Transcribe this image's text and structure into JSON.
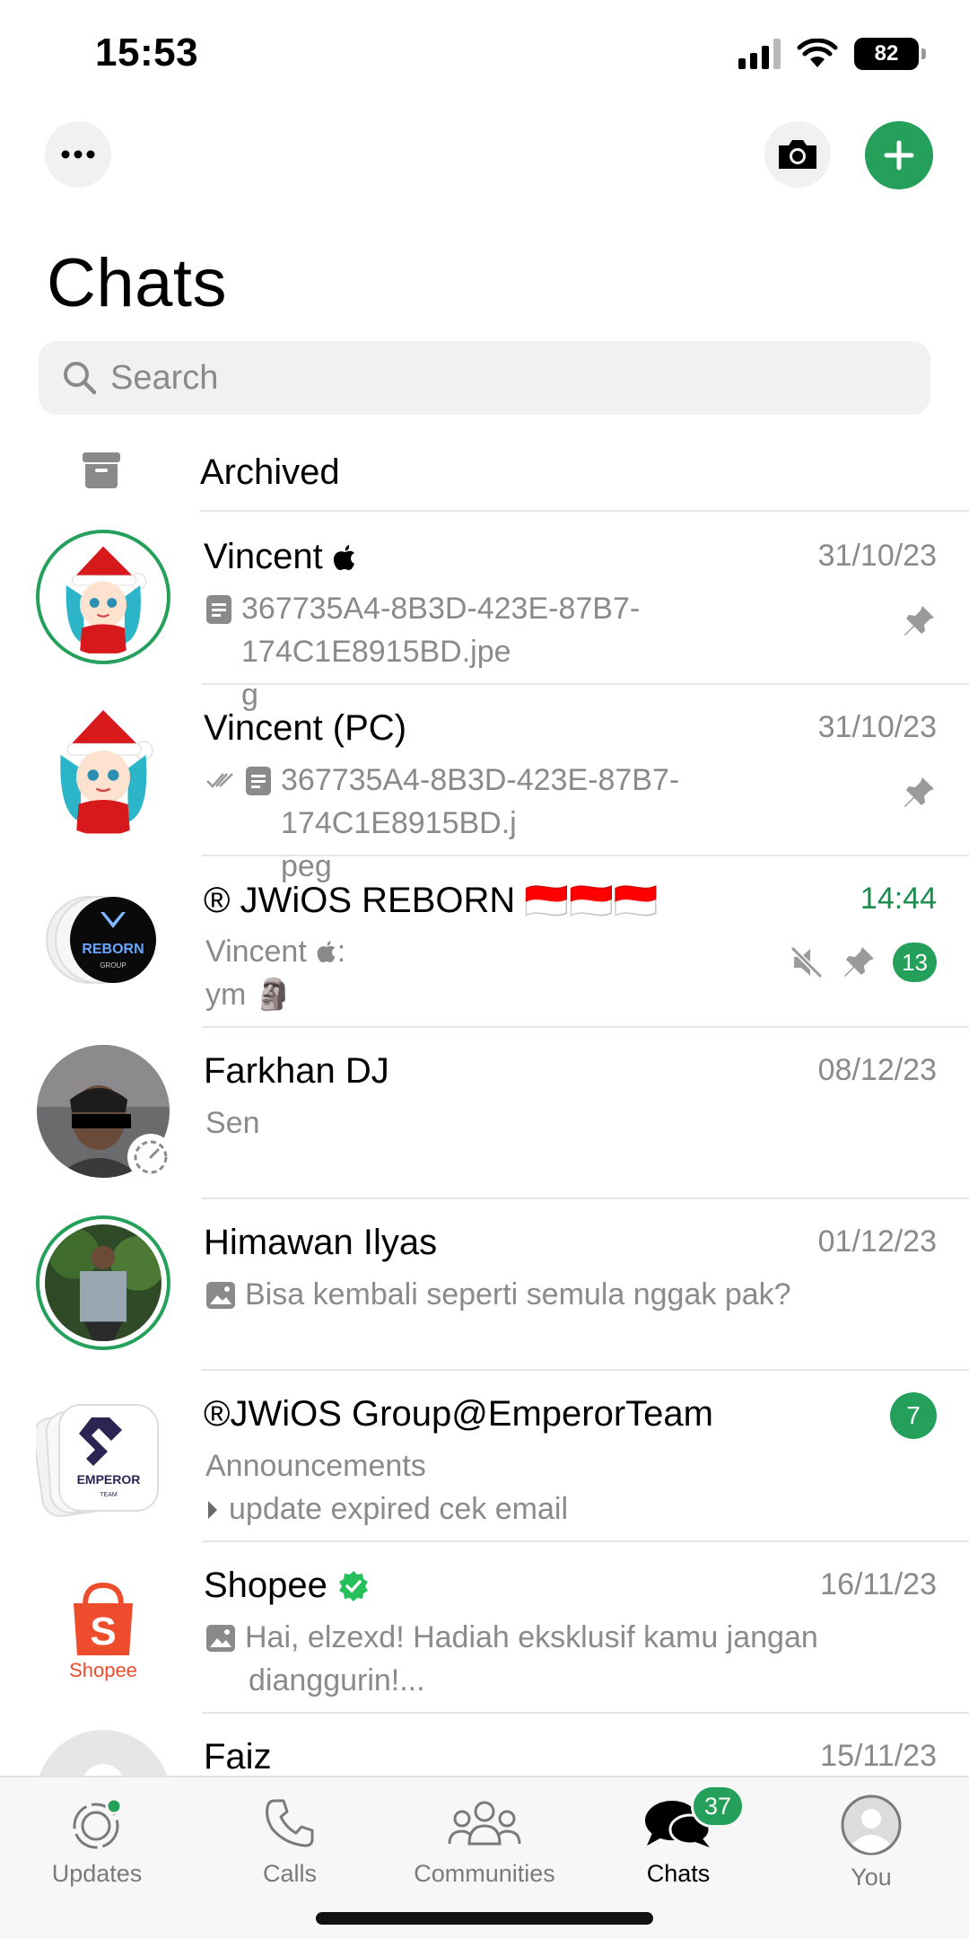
{
  "status_bar": {
    "time": "15:53",
    "battery": "82"
  },
  "header": {
    "title": "Chats"
  },
  "search": {
    "placeholder": "Search"
  },
  "archived": {
    "label": "Archived"
  },
  "chats": [
    {
      "name": "Vincent",
      "name_suffix": "",
      "time": "31/10/23",
      "preview_prefix": "",
      "preview_line1": "367735A4-8B3D-423E-87B7-174C1E8915BD.jpe",
      "preview_line2": "g",
      "badge": ""
    },
    {
      "name": "Vincent (PC)",
      "name_suffix": "",
      "time": "31/10/23",
      "preview_prefix": "",
      "preview_line1": "367735A4-8B3D-423E-87B7-174C1E8915BD.j",
      "preview_line2": "peg",
      "badge": ""
    },
    {
      "name": "® JWiOS REBORN",
      "name_suffix": "🇮🇩🇮🇩🇮🇩",
      "time": "14:44",
      "preview_prefix": "Vincent",
      "preview_line1": ":",
      "preview_line2": "ym 🗿",
      "badge": "13"
    },
    {
      "name": "Farkhan DJ",
      "name_suffix": "",
      "time": "08/12/23",
      "preview_prefix": "",
      "preview_line1": "Sen",
      "preview_line2": "",
      "badge": ""
    },
    {
      "name": "Himawan Ilyas",
      "name_suffix": "",
      "time": "01/12/23",
      "preview_prefix": "",
      "preview_line1": "Bisa kembali seperti semula nggak pak?",
      "preview_line2": "",
      "badge": ""
    },
    {
      "name": "®JWiOS Group@EmperorTeam",
      "name_suffix": "",
      "time": "",
      "preview_prefix": "",
      "preview_line1": "Announcements",
      "preview_line2": "update expired cek email",
      "badge": "7"
    },
    {
      "name": "Shopee",
      "name_suffix": "",
      "time": "16/11/23",
      "preview_prefix": "",
      "preview_line1": "Hai, elzexd! Hadiah eksklusif kamu jangan",
      "preview_line2": "dianggurin!...",
      "badge": ""
    },
    {
      "name": "Faiz",
      "name_suffix": "",
      "time": "15/11/23",
      "preview_prefix": "",
      "preview_line1": "",
      "preview_line2": "",
      "badge": ""
    }
  ],
  "avatars": {
    "reborn_logo_text": "REBORN",
    "reborn_logo_sub": "GROUP",
    "emperor_logo_text": "EMPEROR",
    "emperor_logo_sub": "TEAM",
    "shopee_logo_text": "Shopee"
  },
  "tab_bar": {
    "tabs": [
      {
        "label": "Updates"
      },
      {
        "label": "Calls"
      },
      {
        "label": "Communities"
      },
      {
        "label": "Chats"
      },
      {
        "label": "You"
      }
    ],
    "chats_badge": "37"
  },
  "colors": {
    "accent": "#25a05a",
    "muted_text": "#8a8a8a",
    "divider": "#e6e6e6"
  }
}
